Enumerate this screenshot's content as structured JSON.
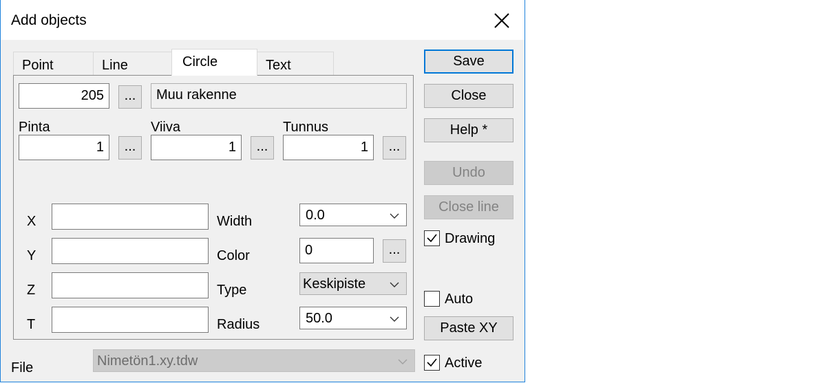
{
  "window": {
    "title": "Add objects"
  },
  "tabs": [
    {
      "label": "Point"
    },
    {
      "label": "Line"
    },
    {
      "label": "Circle"
    },
    {
      "label": "Text"
    }
  ],
  "code": {
    "value": "205",
    "description": "Muu rakenne",
    "browse": "..."
  },
  "pinta": {
    "label": "Pinta",
    "value": "1",
    "browse": "..."
  },
  "viiva": {
    "label": "Viiva",
    "value": "1",
    "browse": "..."
  },
  "tunnus": {
    "label": "Tunnus",
    "value": "1",
    "browse": "..."
  },
  "coords": {
    "x_label": "X",
    "y_label": "Y",
    "z_label": "Z",
    "t_label": "T",
    "x": "",
    "y": "",
    "z": "",
    "t": ""
  },
  "props": {
    "width_label": "Width",
    "width": "0.0",
    "color_label": "Color",
    "color": "0",
    "color_browse": "...",
    "type_label": "Type",
    "type": "Keskipiste",
    "radius_label": "Radius",
    "radius": "50.0"
  },
  "file": {
    "label": "File",
    "value": "Nimetön1.xy.tdw"
  },
  "buttons": {
    "save": "Save",
    "close": "Close",
    "help": "Help *",
    "undo": "Undo",
    "close_line": "Close line",
    "paste_xy": "Paste XY"
  },
  "checks": {
    "drawing_label": "Drawing",
    "drawing": true,
    "auto_label": "Auto",
    "auto": false,
    "active_label": "Active",
    "active": true
  },
  "colors": {
    "accent": "#0078d7",
    "window_border": "#1e82dc"
  }
}
